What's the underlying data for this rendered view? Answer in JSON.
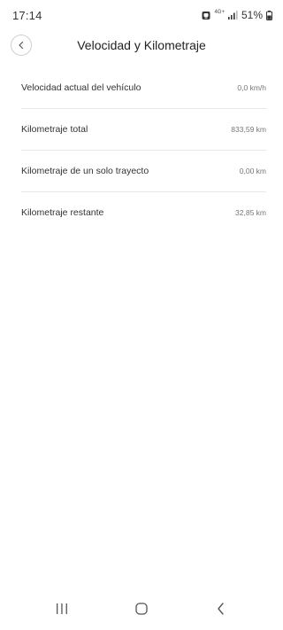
{
  "status_bar": {
    "time": "17:14",
    "network": "4G+",
    "battery": "51%",
    "icons": [
      "app-notification-icon",
      "network-4g-icon",
      "signal-icon",
      "battery-icon"
    ]
  },
  "header": {
    "title": "Velocidad y Kilometraje",
    "back_icon": "chevron-left-icon"
  },
  "rows": [
    {
      "label": "Velocidad actual del vehículo",
      "value": "0,0 km/h"
    },
    {
      "label": "Kilometraje total",
      "value": "833,59 km"
    },
    {
      "label": "Kilometraje de un solo trayecto",
      "value": "0,00 km"
    },
    {
      "label": "Kilometraje restante",
      "value": "32,85 km"
    }
  ],
  "nav_bar": {
    "icons": [
      "recent-apps-icon",
      "home-icon",
      "back-icon"
    ]
  },
  "colors": {
    "background": "#ffffff",
    "divider": "#e6e6e6",
    "text_primary": "#333333",
    "text_secondary": "#777777"
  }
}
